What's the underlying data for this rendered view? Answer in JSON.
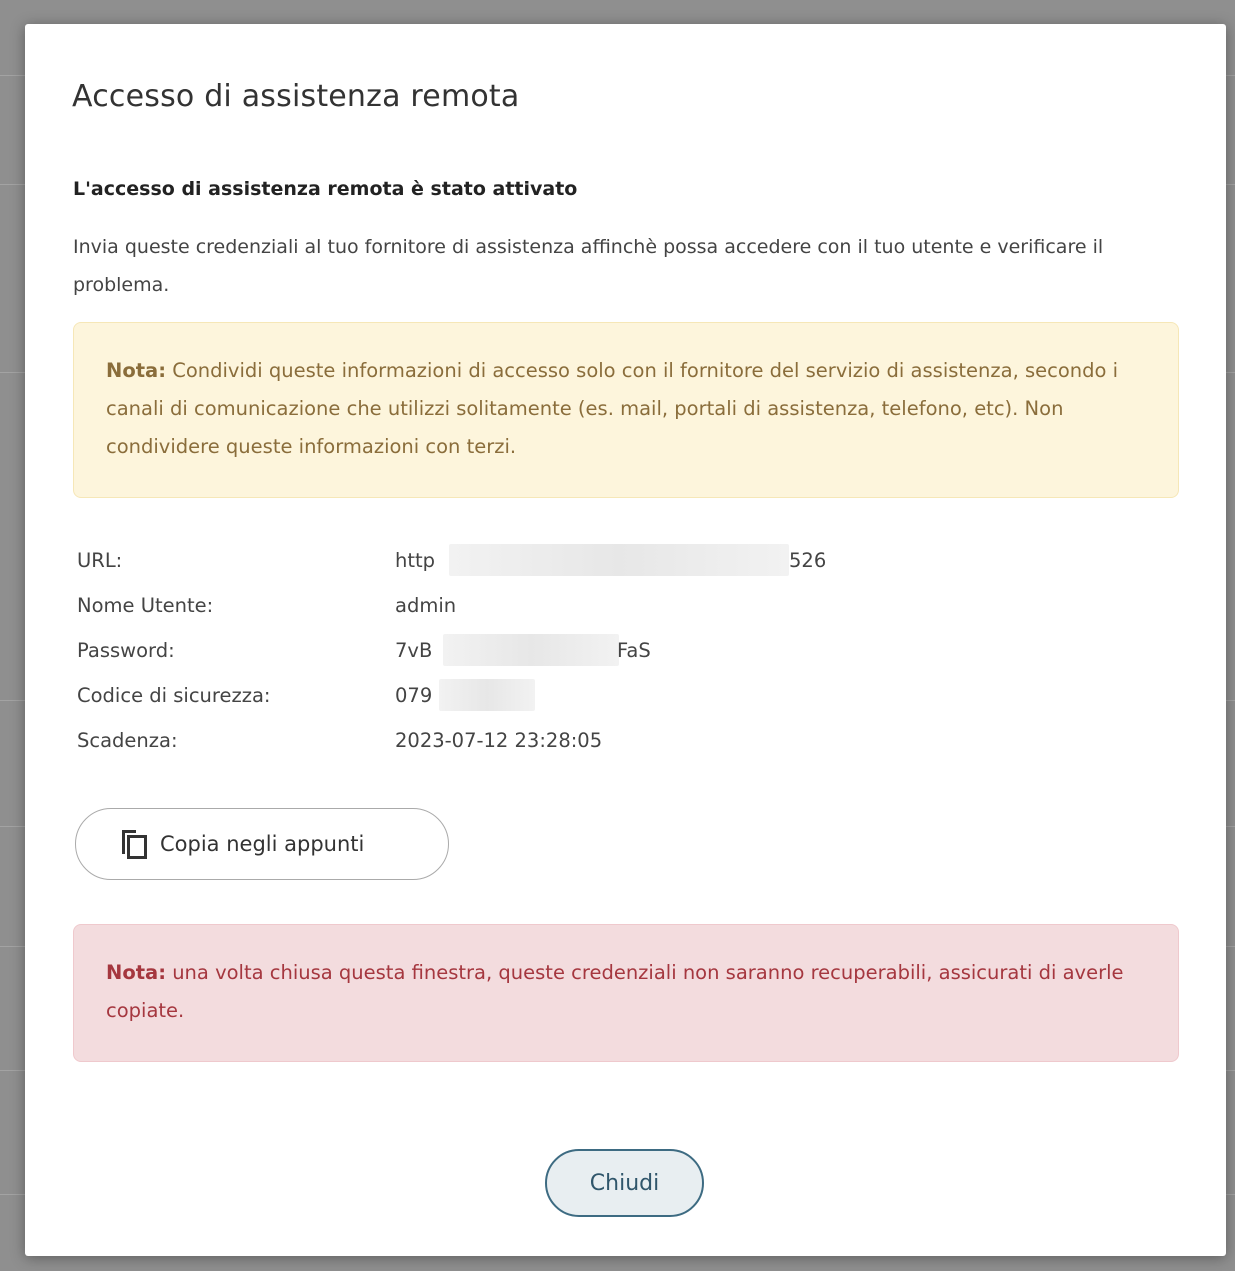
{
  "dialog": {
    "title": "Accesso di assistenza remota",
    "subtitle": "L'accesso di assistenza remota è stato attivato",
    "intro": "Invia queste credenziali al tuo fornitore di assistenza affinchè possa accedere con il tuo utente e verificare il problema.",
    "warning_note": {
      "label": "Nota:",
      "text": " Condividi queste informazioni di accesso solo con il fornitore del servizio di assistenza, secondo i canali di comunicazione che utilizzi solitamente (es. mail, portali di assistenza, telefono, etc). Non condividere queste informazioni con terzi."
    },
    "credentials": [
      {
        "label": "URL:",
        "value_start": "http",
        "value_end": "526"
      },
      {
        "label": "Nome Utente:",
        "value": "admin"
      },
      {
        "label": "Password:",
        "value_start": "7vB",
        "value_end": "FaS"
      },
      {
        "label": "Codice di sicurezza:",
        "value_start": "079"
      },
      {
        "label": "Scadenza:",
        "value": "2023-07-12 23:28:05"
      }
    ],
    "copy_button": {
      "label": "Copia negli appunti",
      "icon": "copy-icon"
    },
    "danger_note": {
      "label": "Nota:",
      "text": " una volta chiusa questa finestra, queste credenziali non saranno recuperabili, assicurati di averle copiate."
    },
    "close_button": {
      "label": "Chiudi"
    }
  }
}
